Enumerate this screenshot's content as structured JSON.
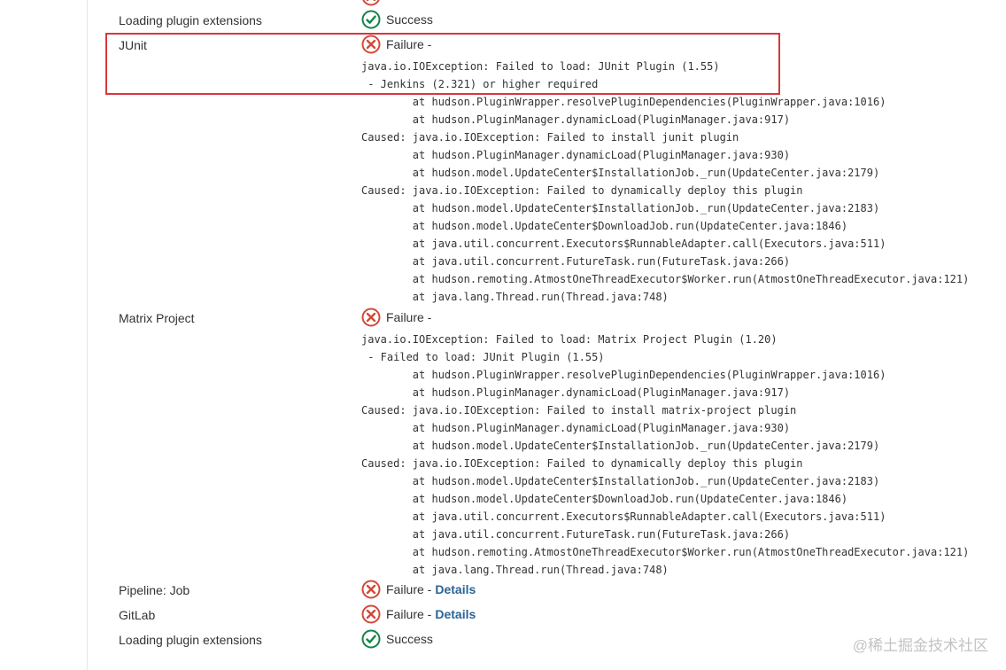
{
  "colors": {
    "failure": "#d24939",
    "success": "#138347",
    "link": "#2a6496",
    "highlight": "#d9363e"
  },
  "rows": [
    {
      "name": "Loading plugin extensions",
      "status_icon": "success-icon",
      "status_text": "Success"
    },
    {
      "name": "JUnit",
      "status_icon": "failure-icon",
      "status_text": "Failure -",
      "trace": "java.io.IOException: Failed to load: JUnit Plugin (1.55)\n - Jenkins (2.321) or higher required\n\tat hudson.PluginWrapper.resolvePluginDependencies(PluginWrapper.java:1016)\n\tat hudson.PluginManager.dynamicLoad(PluginManager.java:917)\nCaused: java.io.IOException: Failed to install junit plugin\n\tat hudson.PluginManager.dynamicLoad(PluginManager.java:930)\n\tat hudson.model.UpdateCenter$InstallationJob._run(UpdateCenter.java:2179)\nCaused: java.io.IOException: Failed to dynamically deploy this plugin\n\tat hudson.model.UpdateCenter$InstallationJob._run(UpdateCenter.java:2183)\n\tat hudson.model.UpdateCenter$DownloadJob.run(UpdateCenter.java:1846)\n\tat java.util.concurrent.Executors$RunnableAdapter.call(Executors.java:511)\n\tat java.util.concurrent.FutureTask.run(FutureTask.java:266)\n\tat hudson.remoting.AtmostOneThreadExecutor$Worker.run(AtmostOneThreadExecutor.java:121)\n\tat java.lang.Thread.run(Thread.java:748)"
    },
    {
      "name": "Matrix Project",
      "status_icon": "failure-icon",
      "status_text": "Failure -",
      "trace": "java.io.IOException: Failed to load: Matrix Project Plugin (1.20)\n - Failed to load: JUnit Plugin (1.55)\n\tat hudson.PluginWrapper.resolvePluginDependencies(PluginWrapper.java:1016)\n\tat hudson.PluginManager.dynamicLoad(PluginManager.java:917)\nCaused: java.io.IOException: Failed to install matrix-project plugin\n\tat hudson.PluginManager.dynamicLoad(PluginManager.java:930)\n\tat hudson.model.UpdateCenter$InstallationJob._run(UpdateCenter.java:2179)\nCaused: java.io.IOException: Failed to dynamically deploy this plugin\n\tat hudson.model.UpdateCenter$InstallationJob._run(UpdateCenter.java:2183)\n\tat hudson.model.UpdateCenter$DownloadJob.run(UpdateCenter.java:1846)\n\tat java.util.concurrent.Executors$RunnableAdapter.call(Executors.java:511)\n\tat java.util.concurrent.FutureTask.run(FutureTask.java:266)\n\tat hudson.remoting.AtmostOneThreadExecutor$Worker.run(AtmostOneThreadExecutor.java:121)\n\tat java.lang.Thread.run(Thread.java:748)"
    },
    {
      "name": "Pipeline: Job",
      "status_icon": "failure-icon",
      "status_text": "Failure -",
      "link_text": "Details"
    },
    {
      "name": "GitLab",
      "status_icon": "failure-icon",
      "status_text": "Failure -",
      "link_text": "Details"
    },
    {
      "name": "Loading plugin extensions",
      "status_icon": "success-icon",
      "status_text": "Success"
    }
  ],
  "watermark": "@稀土掘金技术社区"
}
